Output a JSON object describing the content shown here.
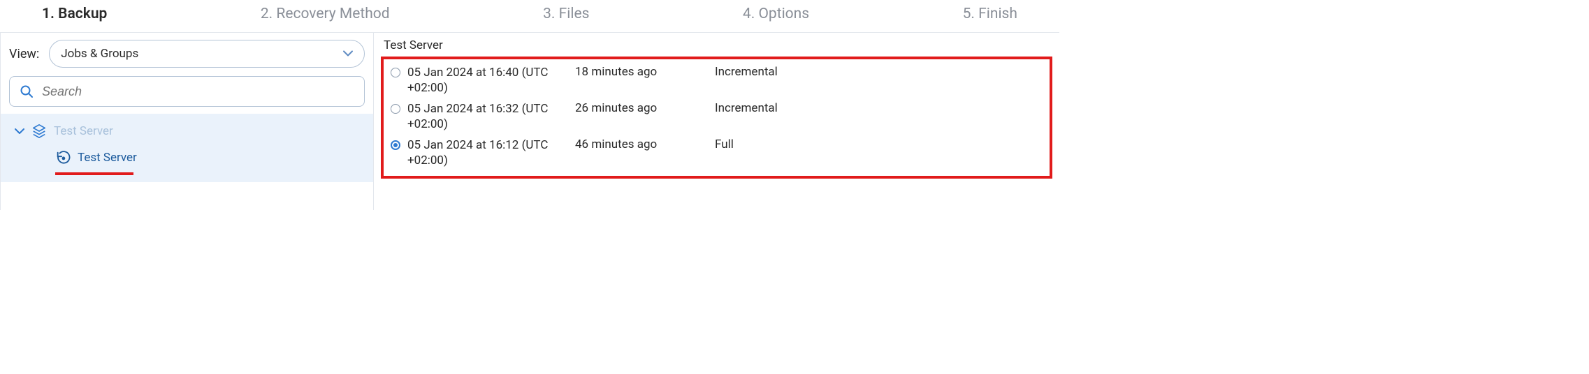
{
  "wizard": {
    "steps": [
      {
        "label": "1. Backup",
        "active": true
      },
      {
        "label": "2. Recovery Method",
        "active": false
      },
      {
        "label": "3. Files",
        "active": false
      },
      {
        "label": "4. Options",
        "active": false
      },
      {
        "label": "5. Finish",
        "active": false
      }
    ]
  },
  "left": {
    "view_label": "View:",
    "view_value": "Jobs & Groups",
    "search_placeholder": "Search",
    "tree": {
      "parent_label": "Test Server",
      "child_label": "Test Server"
    }
  },
  "right": {
    "title": "Test Server",
    "points": [
      {
        "date": "05 Jan 2024 at 16:40 (UTC +02:00)",
        "age": "18 minutes ago",
        "type": "Incremental",
        "selected": false
      },
      {
        "date": "05 Jan 2024 at 16:32 (UTC +02:00)",
        "age": "26 minutes ago",
        "type": "Incremental",
        "selected": false
      },
      {
        "date": "05 Jan 2024 at 16:12 (UTC +02:00)",
        "age": "46 minutes ago",
        "type": "Full",
        "selected": true
      }
    ]
  }
}
